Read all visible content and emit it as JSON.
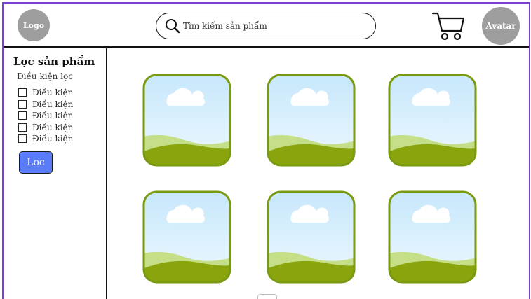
{
  "header": {
    "logo_label": "Logo",
    "search_placeholder": "Tìm kiếm sản phẩm",
    "avatar_label": "Avatar"
  },
  "sidebar": {
    "title": "Lọc sản phẩm",
    "subtitle": "Điều kiện lọc",
    "conditions": [
      "Điều kiện",
      "Điều kiện",
      "Điều kiện",
      "Điều kiện",
      "Điều kiện"
    ],
    "filter_button": "Lọc"
  },
  "products": {
    "count": 6,
    "placeholder_icon": "landscape-image-placeholder"
  },
  "colors": {
    "frame_border": "#7b3fd6",
    "filter_button": "#5b7cf8",
    "placeholder_border": "#7a9a12",
    "avatar_bg": "#9e9e9e"
  }
}
